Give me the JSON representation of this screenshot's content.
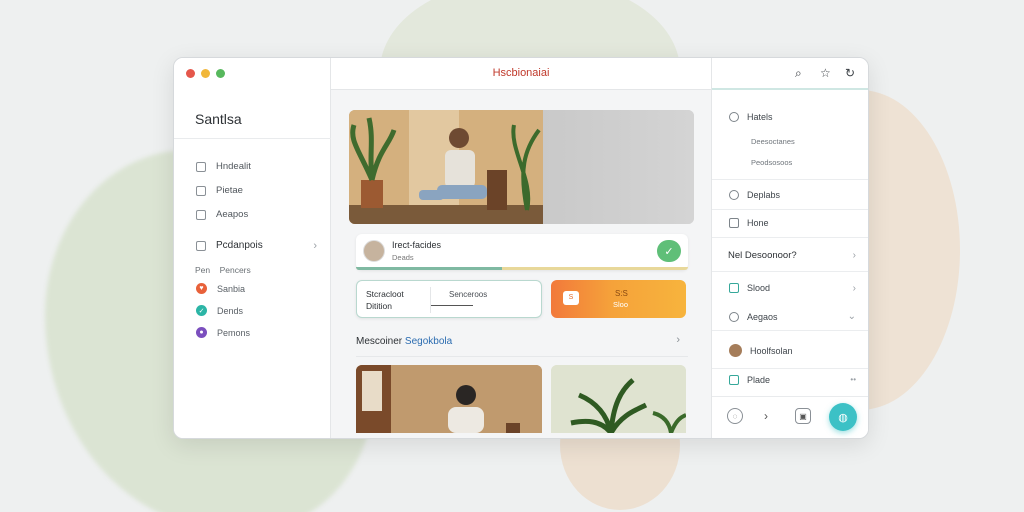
{
  "window": {
    "title": "Hscbionaiai",
    "traffic_colors": [
      "#e5574b",
      "#f1b73a",
      "#57b85d"
    ]
  },
  "sidebar": {
    "brand": "Santlsa",
    "items": [
      {
        "label": "Hndealit",
        "icon": "home-icon"
      },
      {
        "label": "Pietae",
        "icon": "image-icon"
      },
      {
        "label": "Aeapos",
        "icon": "file-icon"
      }
    ],
    "active_item": {
      "label": "Pcdanpois",
      "icon": "folder-icon"
    },
    "group_label": "Pen",
    "group_value": "Pencers",
    "dot_items": [
      {
        "label": "Sanbia",
        "color": "#e8613a",
        "icon": "heart-icon"
      },
      {
        "label": "Dends",
        "color": "#2cb5a6",
        "icon": "check-icon"
      },
      {
        "label": "Pemons",
        "color": "#7b4fbe",
        "icon": "user-icon"
      }
    ]
  },
  "main": {
    "hero_icon": "person-meditating-photo",
    "profile": {
      "name": "Irect-facides",
      "subtitle": "Deads",
      "progress": 0.44,
      "check_icon": "check-icon"
    },
    "stat": {
      "line1": "Stcracloot",
      "line2": "Ditition",
      "right": "Senceroos"
    },
    "orange": {
      "icon_label": "S",
      "title": "S:S",
      "subtitle": "Sloo"
    },
    "section": {
      "title_plain": "Mescoiner",
      "title_link": "Segokbola"
    },
    "thumbs": [
      "seated-person-photo",
      "plant-photo"
    ]
  },
  "right_panel": {
    "top_icons": [
      "search-icon",
      "star-icon",
      "refresh-icon"
    ],
    "header": "Hatels",
    "subs": [
      "Deesoctanes",
      "Peodsosoos"
    ],
    "rows": [
      {
        "label": "Deplabs",
        "icon": "clock-icon"
      },
      {
        "label": "Hone",
        "icon": "list-icon"
      }
    ],
    "bold_row": "Nel Desoonoor?",
    "check_rows": [
      {
        "label": "Slood",
        "icon": "checkbox-icon"
      },
      {
        "label": "Aegaos",
        "icon": "gear-icon"
      }
    ],
    "user_row": "Hoolfsolan",
    "last_row": {
      "label": "Plade",
      "suffix": "••"
    },
    "bottom_icons": [
      "circle-icon",
      "chevron-right-icon",
      "image-icon"
    ],
    "fab_icon": "globe-icon",
    "accent": "#3cc1c6"
  }
}
